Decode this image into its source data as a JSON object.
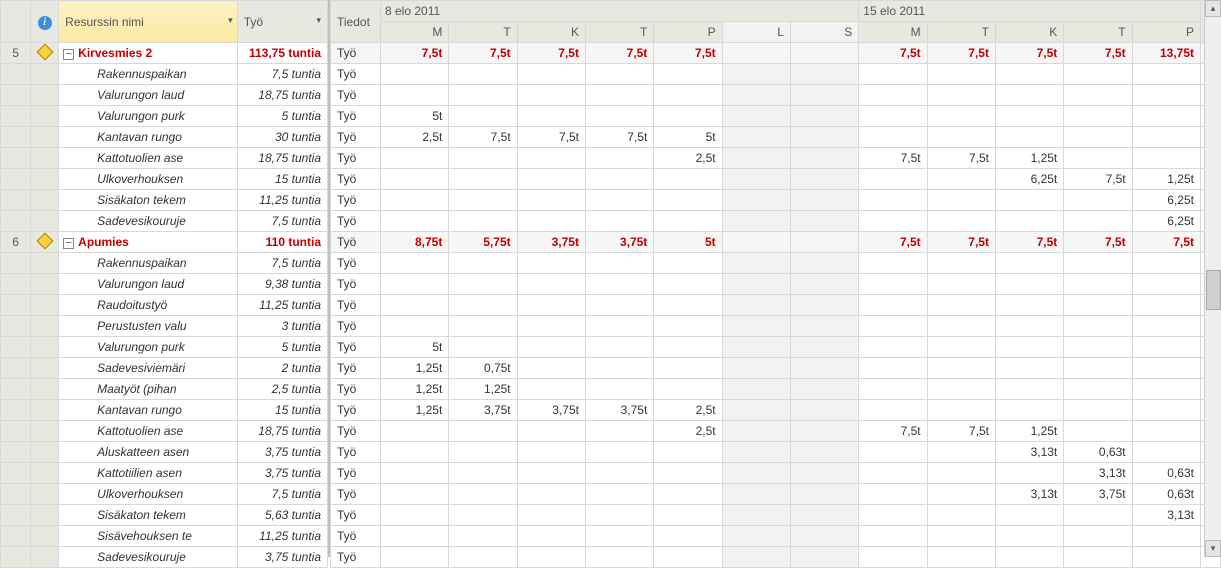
{
  "left": {
    "headers": {
      "info_icon": "i",
      "name": "Resurssin nimi",
      "work": "Työ"
    },
    "rows": [
      {
        "type": "group",
        "num": "5",
        "indicator": true,
        "toggle": "−",
        "name": "Kirvesmies 2",
        "work": "113,75 tuntia"
      },
      {
        "type": "child",
        "name": "Rakennuspaikan",
        "work": "7,5 tuntia"
      },
      {
        "type": "child",
        "name": "Valurungon laud",
        "work": "18,75 tuntia"
      },
      {
        "type": "child",
        "name": "Valurungon purk",
        "work": "5 tuntia"
      },
      {
        "type": "child",
        "name": "Kantavan rungo",
        "work": "30 tuntia"
      },
      {
        "type": "child",
        "name": "Kattotuolien ase",
        "work": "18,75 tuntia"
      },
      {
        "type": "child",
        "name": "Ulkoverhouksen",
        "work": "15 tuntia"
      },
      {
        "type": "child",
        "name": "Sisäkaton tekem",
        "work": "11,25 tuntia"
      },
      {
        "type": "child",
        "name": "Sadevesikouruje",
        "work": "7,5 tuntia"
      },
      {
        "type": "group",
        "num": "6",
        "indicator": true,
        "toggle": "−",
        "name": "Apumies",
        "work": "110 tuntia"
      },
      {
        "type": "child",
        "name": "Rakennuspaikan",
        "work": "7,5 tuntia"
      },
      {
        "type": "child",
        "name": "Valurungon laud",
        "work": "9,38 tuntia"
      },
      {
        "type": "child",
        "name": "Raudoitustyö",
        "work": "11,25 tuntia"
      },
      {
        "type": "child",
        "name": "Perustusten valu",
        "work": "3 tuntia"
      },
      {
        "type": "child",
        "name": "Valurungon purk",
        "work": "5 tuntia"
      },
      {
        "type": "child",
        "name": "Sadevesiviemäri",
        "work": "2 tuntia"
      },
      {
        "type": "child",
        "name": "Maatyöt (pihan",
        "work": "2,5 tuntia"
      },
      {
        "type": "child",
        "name": "Kantavan rungo",
        "work": "15 tuntia"
      },
      {
        "type": "child",
        "name": "Kattotuolien ase",
        "work": "18,75 tuntia"
      },
      {
        "type": "child",
        "name": "Aluskatteen asen",
        "work": "3,75 tuntia"
      },
      {
        "type": "child",
        "name": "Kattotiilien asen",
        "work": "3,75 tuntia"
      },
      {
        "type": "child",
        "name": "Ulkoverhouksen",
        "work": "7,5 tuntia"
      },
      {
        "type": "child",
        "name": "Sisäkaton tekem",
        "work": "5,63 tuntia"
      },
      {
        "type": "child",
        "name": "Sisävehouksen te",
        "work": "11,25 tuntia"
      },
      {
        "type": "child",
        "name": "Sadevesikouruje",
        "work": "3,75 tuntia"
      }
    ]
  },
  "right": {
    "tiedot": "Tiedot",
    "weeks": [
      "8 elo 2011",
      "15 elo 2011"
    ],
    "days": [
      "M",
      "T",
      "K",
      "T",
      "P",
      "L",
      "S",
      "M",
      "T",
      "K",
      "T",
      "P"
    ],
    "tyo": "Työ",
    "rows": [
      {
        "group": true,
        "cells": [
          "7,5t",
          "7,5t",
          "7,5t",
          "7,5t",
          "7,5t",
          "",
          "",
          "7,5t",
          "7,5t",
          "7,5t",
          "7,5t",
          "13,75t"
        ],
        "red_last": true
      },
      {
        "cells": [
          "",
          "",
          "",
          "",
          "",
          "",
          "",
          "",
          "",
          "",
          "",
          ""
        ]
      },
      {
        "cells": [
          "",
          "",
          "",
          "",
          "",
          "",
          "",
          "",
          "",
          "",
          "",
          ""
        ]
      },
      {
        "cells": [
          "5t",
          "",
          "",
          "",
          "",
          "",
          "",
          "",
          "",
          "",
          "",
          ""
        ]
      },
      {
        "cells": [
          "2,5t",
          "7,5t",
          "7,5t",
          "7,5t",
          "5t",
          "",
          "",
          "",
          "",
          "",
          "",
          ""
        ]
      },
      {
        "cells": [
          "",
          "",
          "",
          "",
          "2,5t",
          "",
          "",
          "7,5t",
          "7,5t",
          "1,25t",
          "",
          ""
        ]
      },
      {
        "cells": [
          "",
          "",
          "",
          "",
          "",
          "",
          "",
          "",
          "",
          "6,25t",
          "7,5t",
          "1,25t"
        ]
      },
      {
        "cells": [
          "",
          "",
          "",
          "",
          "",
          "",
          "",
          "",
          "",
          "",
          "",
          "6,25t"
        ]
      },
      {
        "cells": [
          "",
          "",
          "",
          "",
          "",
          "",
          "",
          "",
          "",
          "",
          "",
          "6,25t"
        ]
      },
      {
        "group": true,
        "cells": [
          "8,75t",
          "5,75t",
          "3,75t",
          "3,75t",
          "5t",
          "",
          "",
          "7,5t",
          "7,5t",
          "7,5t",
          "7,5t",
          "7,5t"
        ]
      },
      {
        "cells": [
          "",
          "",
          "",
          "",
          "",
          "",
          "",
          "",
          "",
          "",
          "",
          ""
        ]
      },
      {
        "cells": [
          "",
          "",
          "",
          "",
          "",
          "",
          "",
          "",
          "",
          "",
          "",
          ""
        ]
      },
      {
        "cells": [
          "",
          "",
          "",
          "",
          "",
          "",
          "",
          "",
          "",
          "",
          "",
          ""
        ]
      },
      {
        "cells": [
          "",
          "",
          "",
          "",
          "",
          "",
          "",
          "",
          "",
          "",
          "",
          ""
        ]
      },
      {
        "cells": [
          "5t",
          "",
          "",
          "",
          "",
          "",
          "",
          "",
          "",
          "",
          "",
          ""
        ]
      },
      {
        "cells": [
          "1,25t",
          "0,75t",
          "",
          "",
          "",
          "",
          "",
          "",
          "",
          "",
          "",
          ""
        ]
      },
      {
        "cells": [
          "1,25t",
          "1,25t",
          "",
          "",
          "",
          "",
          "",
          "",
          "",
          "",
          "",
          ""
        ]
      },
      {
        "cells": [
          "1,25t",
          "3,75t",
          "3,75t",
          "3,75t",
          "2,5t",
          "",
          "",
          "",
          "",
          "",
          "",
          ""
        ]
      },
      {
        "cells": [
          "",
          "",
          "",
          "",
          "2,5t",
          "",
          "",
          "7,5t",
          "7,5t",
          "1,25t",
          "",
          ""
        ]
      },
      {
        "cells": [
          "",
          "",
          "",
          "",
          "",
          "",
          "",
          "",
          "",
          "3,13t",
          "0,63t",
          ""
        ]
      },
      {
        "cells": [
          "",
          "",
          "",
          "",
          "",
          "",
          "",
          "",
          "",
          "",
          "3,13t",
          "0,63t"
        ]
      },
      {
        "cells": [
          "",
          "",
          "",
          "",
          "",
          "",
          "",
          "",
          "",
          "3,13t",
          "3,75t",
          "0,63t"
        ]
      },
      {
        "cells": [
          "",
          "",
          "",
          "",
          "",
          "",
          "",
          "",
          "",
          "",
          "",
          "3,13t"
        ]
      },
      {
        "cells": [
          "",
          "",
          "",
          "",
          "",
          "",
          "",
          "",
          "",
          "",
          "",
          ""
        ]
      },
      {
        "cells": [
          "",
          "",
          "",
          "",
          "",
          "",
          "",
          "",
          "",
          "",
          "",
          ""
        ]
      }
    ]
  }
}
